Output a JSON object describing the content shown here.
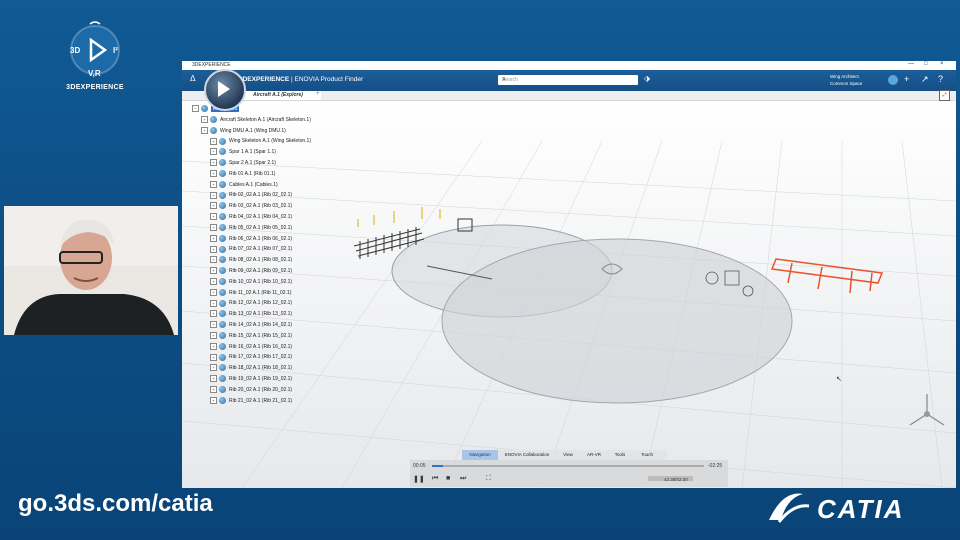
{
  "logo": {
    "text": "3DEXPERIENCE",
    "letters": {
      "left": "3D",
      "right": "I²",
      "bottom": "V,R"
    }
  },
  "url": "go.3ds.com/catia",
  "brand_logo_text": "CATIA",
  "window": {
    "title": "3DEXPERIENCE",
    "controls": [
      "—",
      "□",
      "×"
    ],
    "app_brand": "3DEXPERIENCE",
    "app_name": "ENOVIA Product Finder",
    "search_placeholder": "Search",
    "user_line1": "Wing Architect",
    "user_line2": "Common Space",
    "tab_label": "Aircraft A.1 (Explore)",
    "tab_add": "+"
  },
  "tree": {
    "root": "Aircraft A.1",
    "items": [
      {
        "indent": 1,
        "label": "Aircraft Skeleton A.1 (Aircraft Skeleton.1)"
      },
      {
        "indent": 1,
        "label": "Wing DMU A.1 (Wing DMU.1)"
      },
      {
        "indent": 2,
        "label": "Wing Skeleton A.1 (Wing Skeleton.1)"
      },
      {
        "indent": 2,
        "label": "Spar 1 A.1 (Spar 1.1)"
      },
      {
        "indent": 2,
        "label": "Spar 2 A.1 (Spar 2.1)"
      },
      {
        "indent": 2,
        "label": "Rib 01 A.1 (Rib 01.1)"
      },
      {
        "indent": 2,
        "label": "Cables A.1 (Cables.1)"
      },
      {
        "indent": 2,
        "label": "Rib 02_02 A.1 (Rib 02_02.1)"
      },
      {
        "indent": 2,
        "label": "Rib 03_02 A.1 (Rib 03_02.1)"
      },
      {
        "indent": 2,
        "label": "Rib 04_02 A.1 (Rib 04_02.1)"
      },
      {
        "indent": 2,
        "label": "Rib 05_02 A.1 (Rib 05_02.1)"
      },
      {
        "indent": 2,
        "label": "Rib 06_02 A.1 (Rib 06_02.1)"
      },
      {
        "indent": 2,
        "label": "Rib 07_02 A.1 (Rib 07_02.1)"
      },
      {
        "indent": 2,
        "label": "Rib 08_02 A.1 (Rib 08_02.1)"
      },
      {
        "indent": 2,
        "label": "Rib 09_02 A.1 (Rib 09_02.1)"
      },
      {
        "indent": 2,
        "label": "Rib 10_02 A.1 (Rib 10_02.1)"
      },
      {
        "indent": 2,
        "label": "Rib 11_02 A.1 (Rib 11_02.1)"
      },
      {
        "indent": 2,
        "label": "Rib 12_02 A.1 (Rib 12_02.1)"
      },
      {
        "indent": 2,
        "label": "Rib 13_02 A.1 (Rib 13_02.1)"
      },
      {
        "indent": 2,
        "label": "Rib 14_02 A.1 (Rib 14_02.1)"
      },
      {
        "indent": 2,
        "label": "Rib 15_02 A.1 (Rib 15_02.1)"
      },
      {
        "indent": 2,
        "label": "Rib 16_02 A.1 (Rib 16_02.1)"
      },
      {
        "indent": 2,
        "label": "Rib 17_02 A.1 (Rib 17_02.1)"
      },
      {
        "indent": 2,
        "label": "Rib 18_02 A.1 (Rib 18_02.1)"
      },
      {
        "indent": 2,
        "label": "Rib 19_02 A.1 (Rib 19_02.1)"
      },
      {
        "indent": 2,
        "label": "Rib 20_02 A.1 (Rib 20_02.1)"
      },
      {
        "indent": 2,
        "label": "Rib 21_02 A.1 (Rib 21_02.1)"
      }
    ]
  },
  "action_bar": {
    "tabs": [
      "Navigation",
      "ENOVIA Collaboration",
      "View",
      "AR-VR",
      "Tools",
      "Touch"
    ],
    "active": "Navigation"
  },
  "player": {
    "elapsed": "00:05",
    "remaining": "-02:25",
    "timecode": "42:38/02:30",
    "progress": 0.04
  },
  "colors": {
    "accent": "#2b6fc2",
    "background": "#0c4c82",
    "selection": "#e8552b"
  }
}
